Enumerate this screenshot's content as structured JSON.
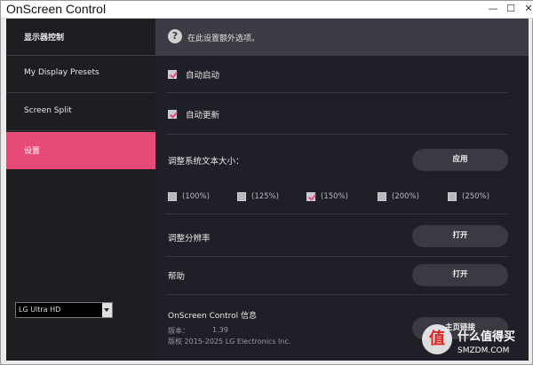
{
  "window": {
    "title": "OnScreen Control",
    "min_glyph": "—",
    "max_glyph": "☐",
    "close_glyph": "✕"
  },
  "sidebar": {
    "items": [
      {
        "label": "显示器控制",
        "active": false
      },
      {
        "label": "My Display Presets",
        "active": false
      },
      {
        "label": "Screen Split",
        "active": false
      },
      {
        "label": "设置",
        "active": true
      }
    ],
    "monitor_select": {
      "value": "LG Ultra HD"
    }
  },
  "main": {
    "info": {
      "icon": "question-icon",
      "text": "在此设置额外选项。"
    },
    "auto_start": {
      "label": "自动启动",
      "checked": true
    },
    "auto_update": {
      "label": "自动更新",
      "checked": true
    },
    "text_size": {
      "label": "调整系统文本大小：",
      "apply_label": "应用",
      "options": [
        {
          "label": "(100%)",
          "checked": false
        },
        {
          "label": "(125%)",
          "checked": false
        },
        {
          "label": "(150%)",
          "checked": true
        },
        {
          "label": "(200%)",
          "checked": false
        },
        {
          "label": "(250%)",
          "checked": false
        }
      ]
    },
    "resolution": {
      "label": "调整分辨率",
      "button_label": "打开"
    },
    "help": {
      "label": "帮助",
      "button_label": "打开"
    },
    "about": {
      "title": "OnScreen Control 信息",
      "version_label": "版本：",
      "version_value": "1.39",
      "copyright": "版权 2015-2025 LG Electronics Inc.",
      "homepage_label": "主页链接"
    }
  },
  "watermark": {
    "glyph": "值",
    "line1": "什么值得买",
    "line2": "SMZDM.COM"
  },
  "colors": {
    "accent": "#e84a78",
    "sidebar_bg": "#1d1d22",
    "main_bg": "#1f1f27",
    "button_bg": "#3a3a42"
  }
}
